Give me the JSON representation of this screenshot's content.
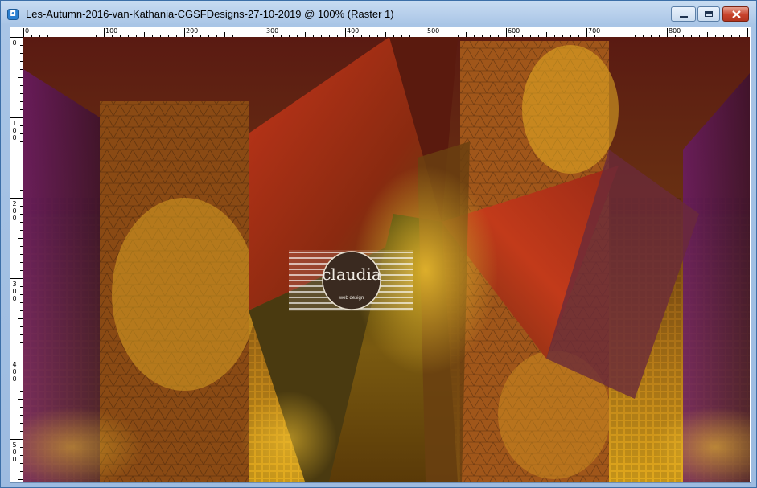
{
  "window": {
    "title": "Les-Autumn-2016-van-Kathania-CGSFDesigns-27-10-2019 @ 100% (Raster 1)",
    "app_icon": "paint-shop-pro-icon",
    "controls": [
      "minimize-icon",
      "maximize-icon",
      "close-icon"
    ]
  },
  "ruler": {
    "top_labels": [
      "0",
      "100",
      "200",
      "300",
      "400",
      "500",
      "600",
      "700",
      "800"
    ],
    "left_labels": [
      "0",
      "100",
      "200",
      "300",
      "400",
      "500"
    ]
  },
  "watermark": {
    "name": "claudia",
    "tagline": "web design"
  },
  "colors": {
    "titlebar": "#a9c5e6",
    "close_button": "#c8432c",
    "image_red": "#b8301a",
    "image_gold": "#d9a21a",
    "image_purple": "#5a1858",
    "image_olive": "#5a5a10"
  }
}
